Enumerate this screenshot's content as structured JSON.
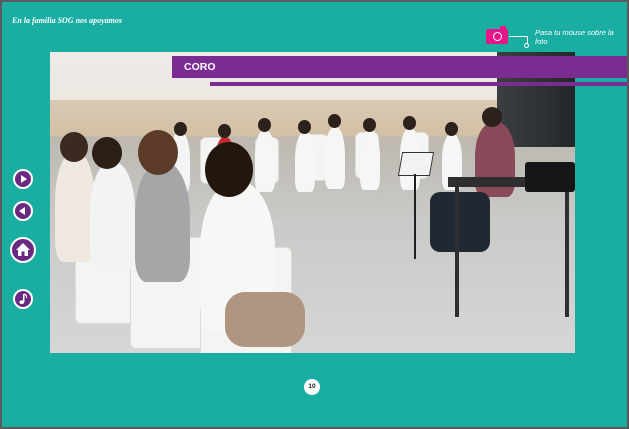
{
  "header": {
    "brand_text": "En la familia SOG nos apoyamos"
  },
  "photo_hint": {
    "icon": "camera-icon",
    "text": "Pasa tu mouse sobre la foto"
  },
  "section": {
    "title": "CORO"
  },
  "nav": {
    "icons": [
      "play-next-icon",
      "play-previous-icon",
      "home-icon",
      "music-note-icon"
    ]
  },
  "footer": {
    "page_number": "10"
  },
  "colors": {
    "background": "#1aaea3",
    "accent_purple": "#7b2c92",
    "camera_pink": "#e6168a",
    "frame": "#5a5a5a"
  }
}
